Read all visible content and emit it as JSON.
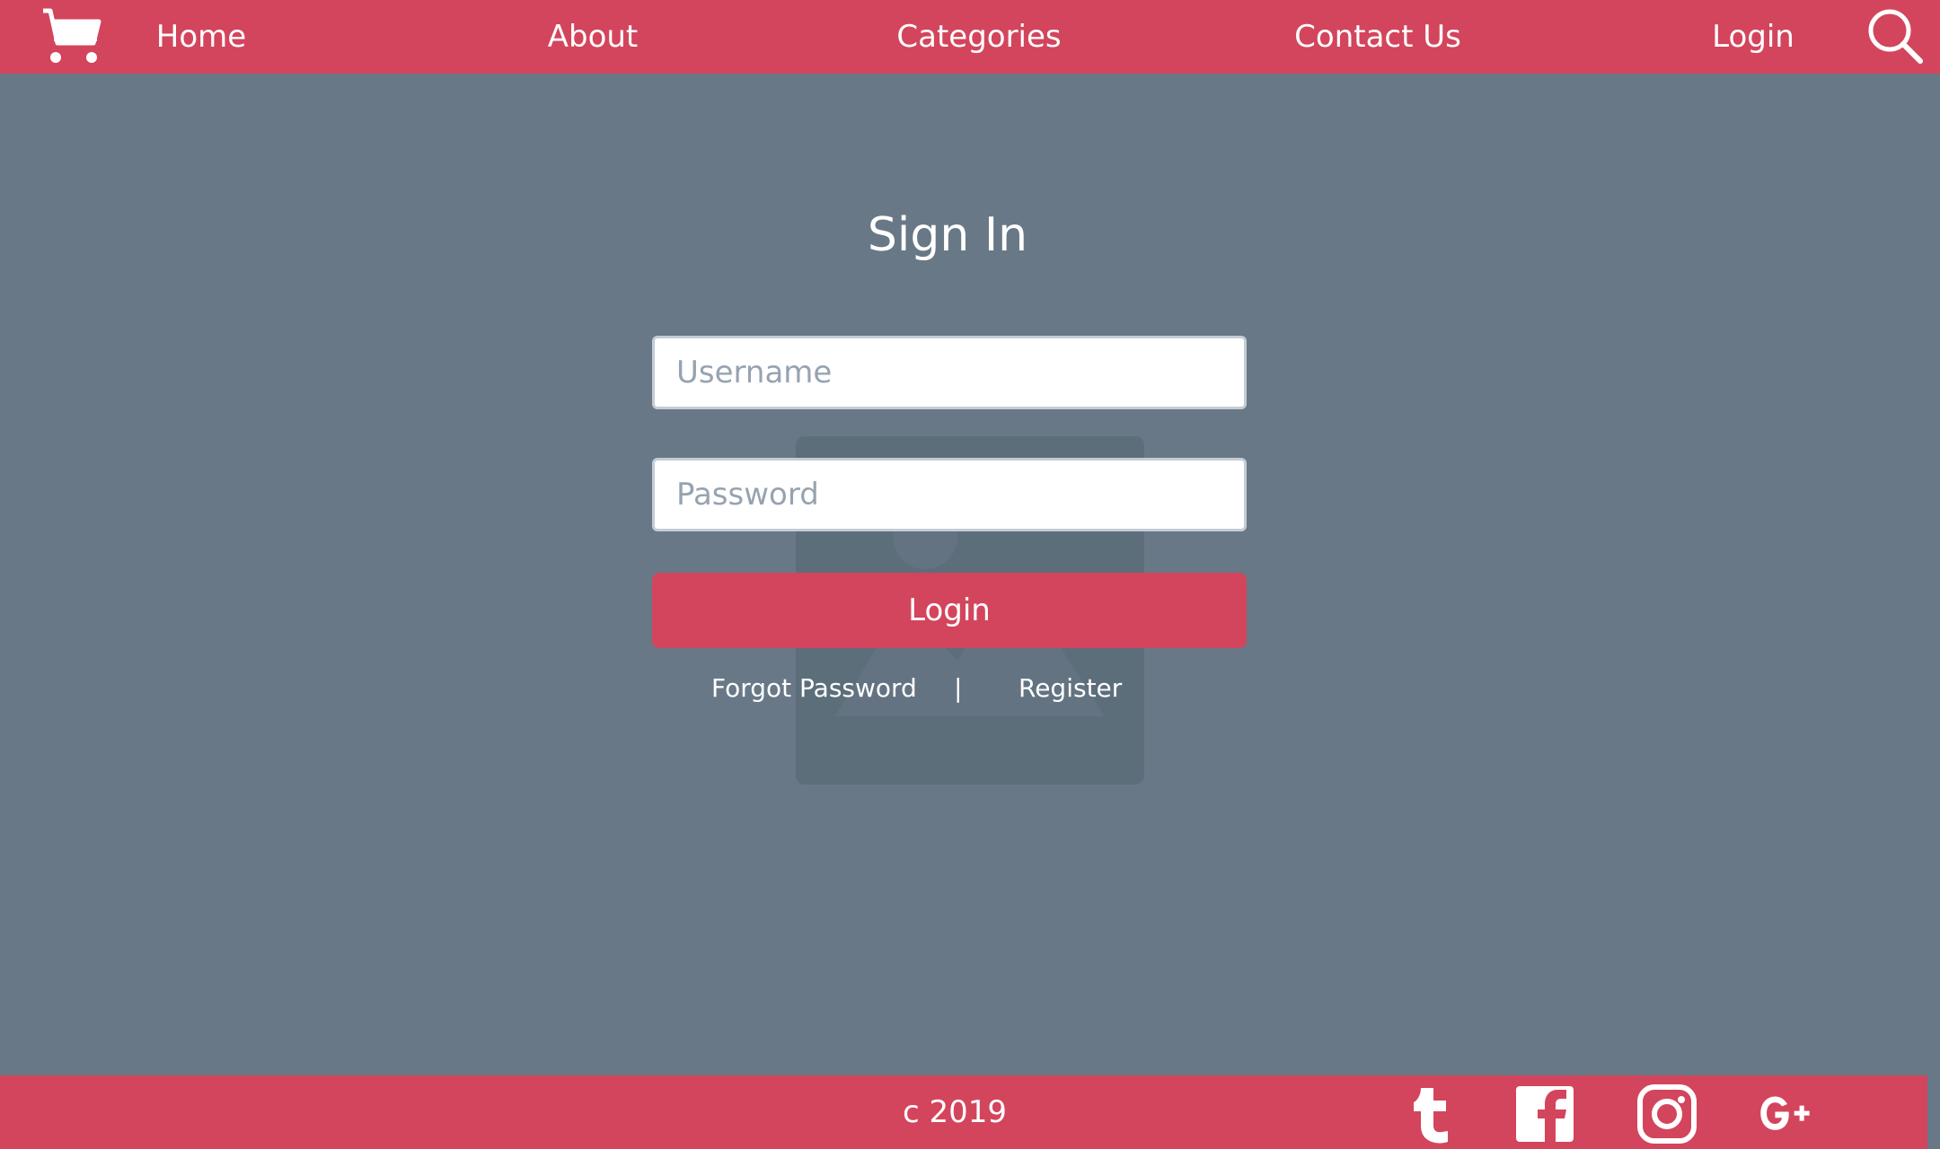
{
  "nav": {
    "home": "Home",
    "about": "About",
    "categories": "Categories",
    "contact": "Contact Us",
    "login": "Login"
  },
  "icons": {
    "cart": "shopping-cart-icon",
    "search": "search-icon",
    "placeholder": "image-placeholder-icon",
    "tumblr": "tumblr-icon",
    "facebook": "facebook-icon",
    "instagram": "instagram-icon",
    "googleplus": "google-plus-icon"
  },
  "form": {
    "title": "Sign In",
    "username_placeholder": "Username",
    "password_placeholder": "Password",
    "login_button": "Login",
    "forgot_password": "Forgot Password",
    "separator": "|",
    "register": "Register"
  },
  "footer": {
    "copyright": "c 2019"
  },
  "colors": {
    "brand": "#d3455c",
    "background": "#687886"
  }
}
